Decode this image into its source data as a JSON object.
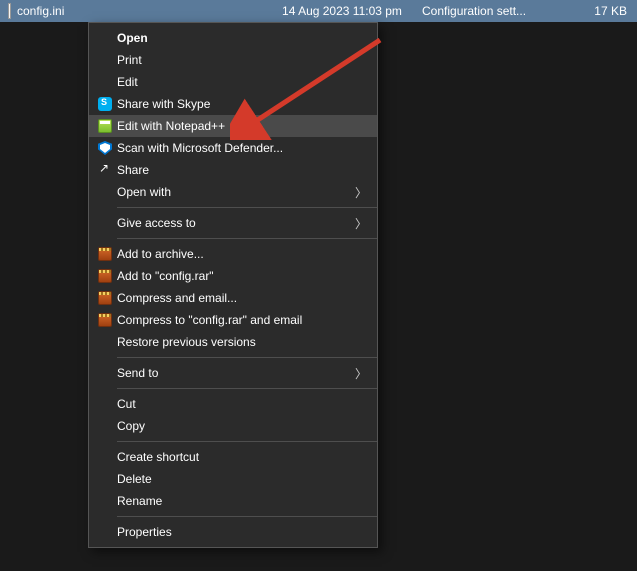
{
  "file_row": {
    "name": "config.ini",
    "date": "14 Aug 2023 11:03 pm",
    "type": "Configuration sett...",
    "size": "17 KB"
  },
  "menu": {
    "open": "Open",
    "print": "Print",
    "edit": "Edit",
    "share_skype": "Share with Skype",
    "edit_notepadpp": "Edit with Notepad++",
    "scan_defender": "Scan with Microsoft Defender...",
    "share": "Share",
    "open_with": "Open with",
    "give_access": "Give access to",
    "add_archive": "Add to archive...",
    "add_config_rar": "Add to \"config.rar\"",
    "compress_email": "Compress and email...",
    "compress_config_email": "Compress to \"config.rar\" and email",
    "restore_prev": "Restore previous versions",
    "send_to": "Send to",
    "cut": "Cut",
    "copy": "Copy",
    "create_shortcut": "Create shortcut",
    "delete": "Delete",
    "rename": "Rename",
    "properties": "Properties"
  },
  "annotation": {
    "color": "#d43a2a"
  }
}
